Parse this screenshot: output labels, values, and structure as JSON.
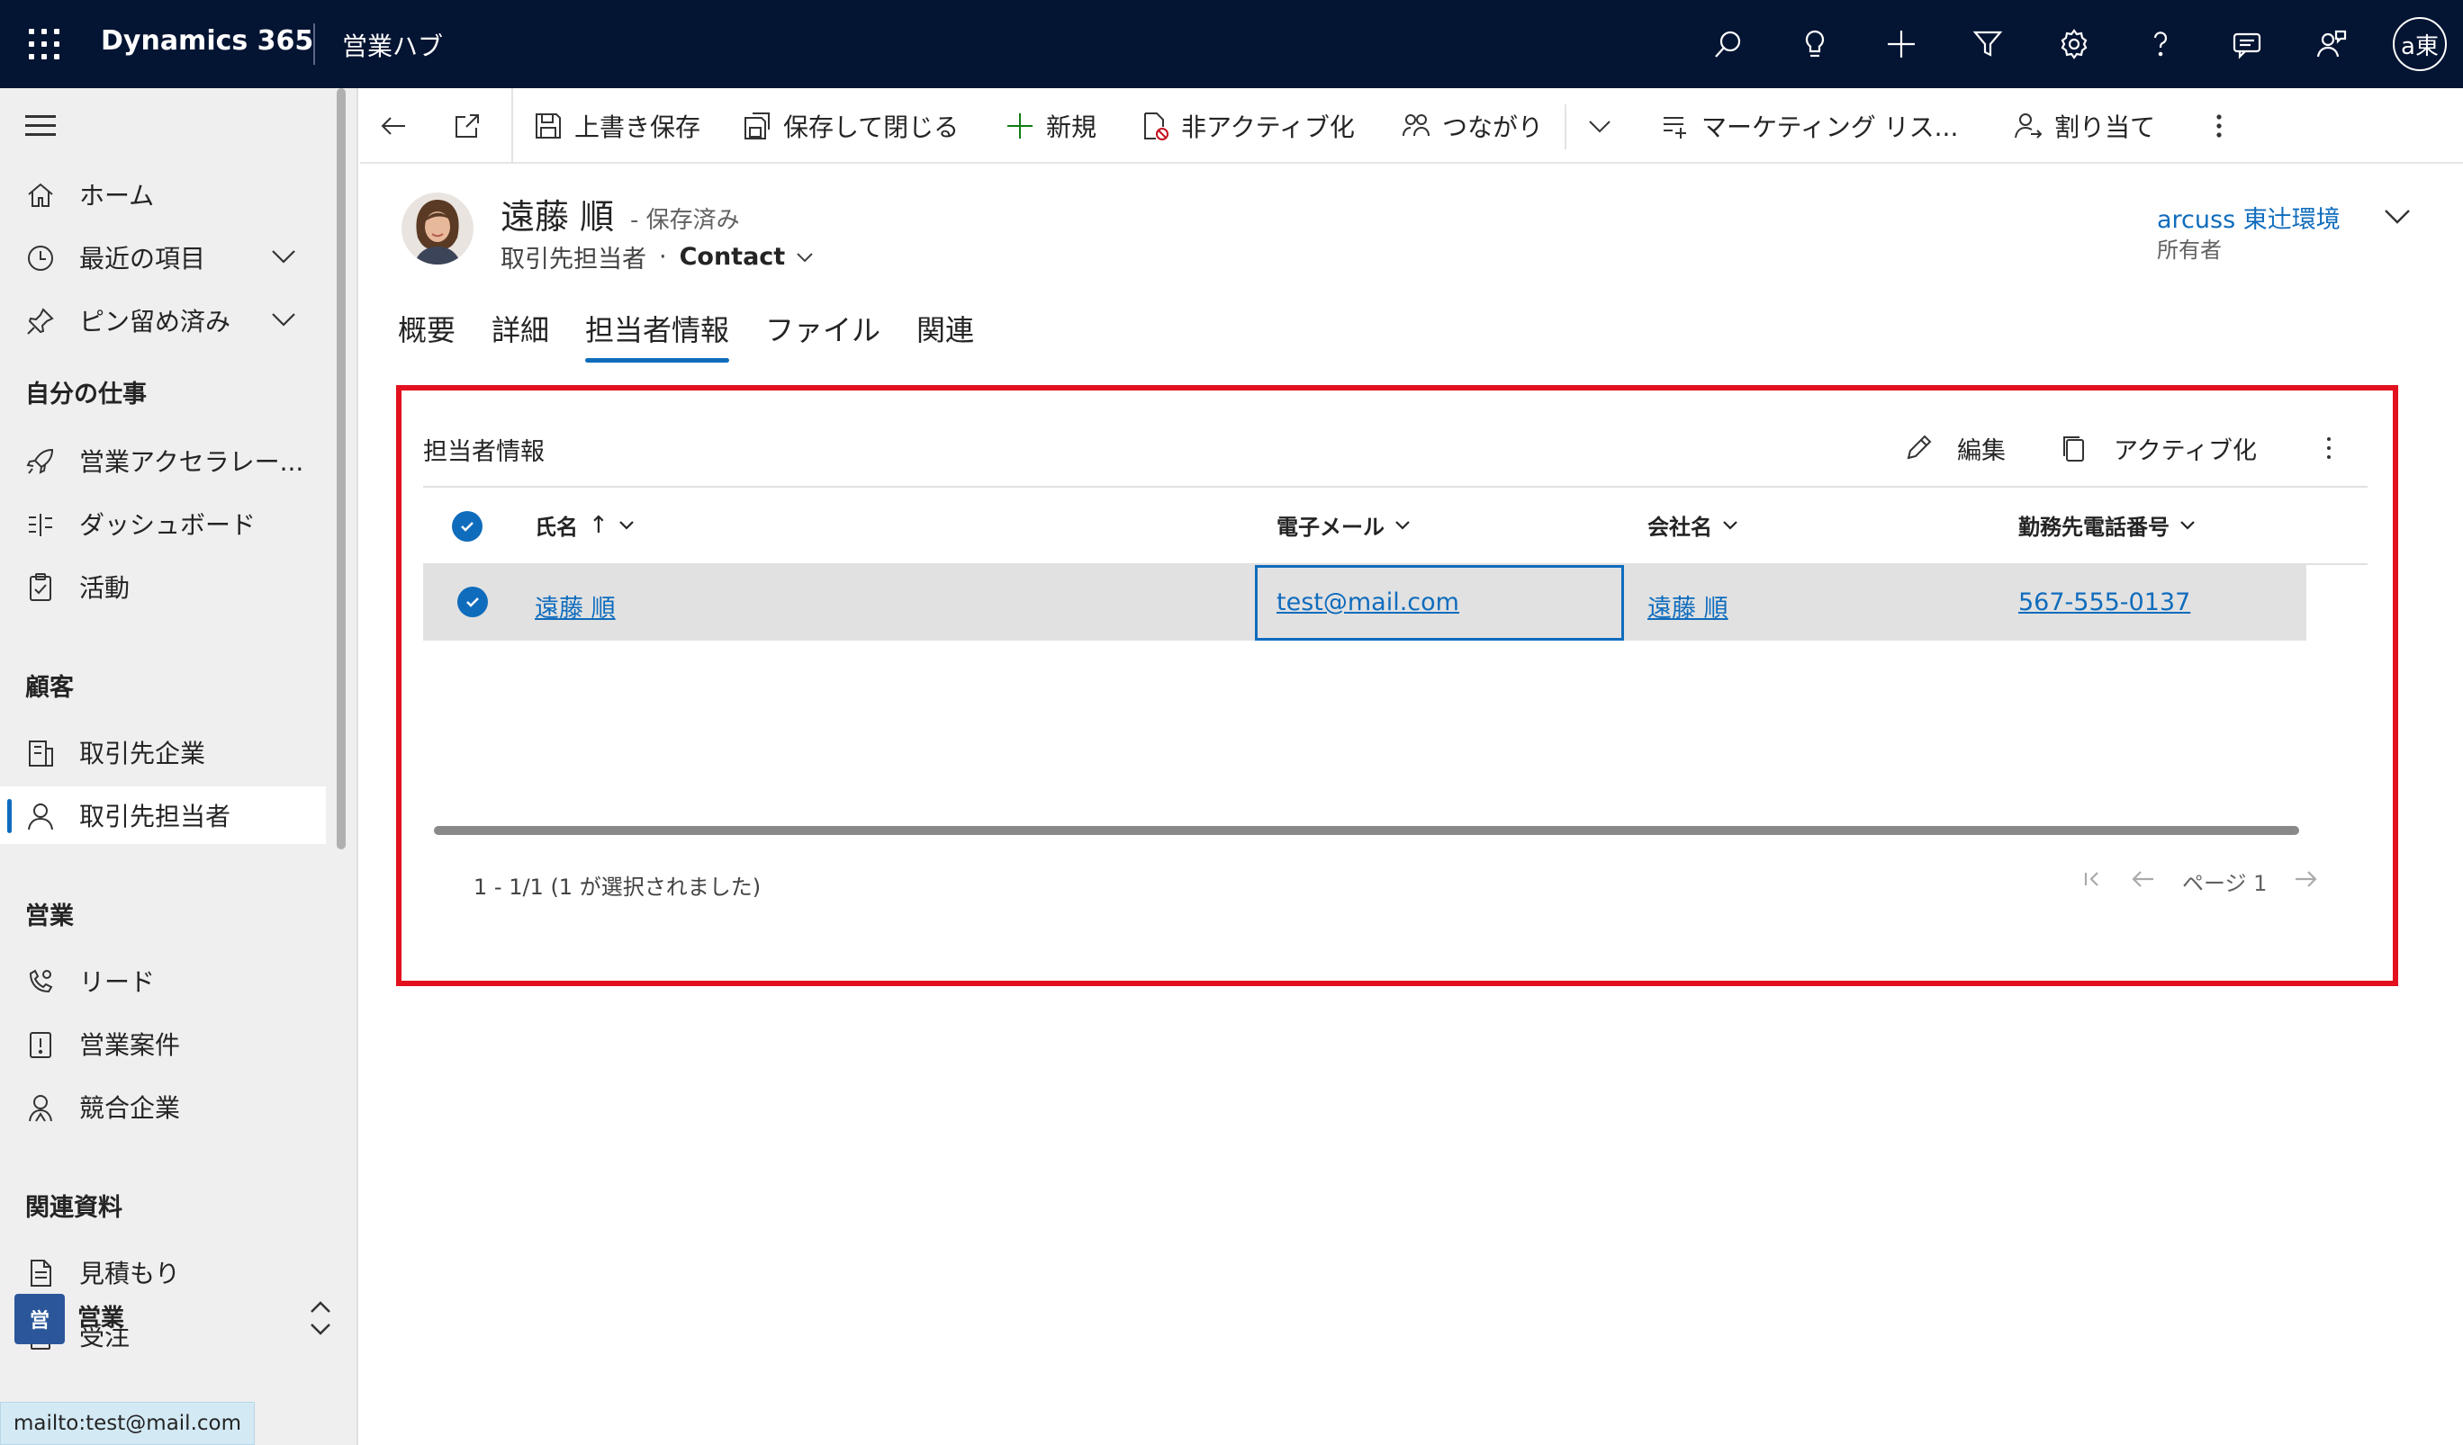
{
  "topbar": {
    "app_name": "Dynamics 365",
    "hub_name": "営業ハブ",
    "user_initials": "a東"
  },
  "icons": {
    "search": "search-icon",
    "lightbulb": "lightbulb-icon",
    "add": "plus-icon",
    "filter": "filter-icon",
    "settings": "gear-icon",
    "help": "help-icon",
    "chat": "chat-icon",
    "assistant": "person-feedback-icon"
  },
  "sidebar": {
    "items": [
      {
        "label": "ホーム"
      },
      {
        "label": "最近の項目"
      },
      {
        "label": "ピン留め済み"
      },
      {
        "label": "営業アクセラレー..."
      },
      {
        "label": "ダッシュボード"
      },
      {
        "label": "活動"
      },
      {
        "label": "取引先企業"
      },
      {
        "label": "取引先担当者"
      },
      {
        "label": "リード"
      },
      {
        "label": "営業案件"
      },
      {
        "label": "競合企業"
      },
      {
        "label": "見積もり"
      },
      {
        "label": "受注"
      }
    ],
    "groups": {
      "my_work": "自分の仕事",
      "customers": "顧客",
      "sales": "営業",
      "collateral": "関連資料"
    },
    "area_badge": "営",
    "area_label": "営業",
    "status_url": "mailto:test@mail.com"
  },
  "commandbar": {
    "save": "上書き保存",
    "save_close": "保存して閉じる",
    "new": "新規",
    "deactivate": "非アクティブ化",
    "connect": "つながり",
    "marketing_list": "マーケティング リス...",
    "assign": "割り当て"
  },
  "record": {
    "name": "遠藤 順",
    "status": "- 保存済み",
    "entity": "取引先担当者",
    "form": "Contact",
    "owner_name": "arcuss 東辻環境",
    "owner_label": "所有者"
  },
  "tabs": [
    {
      "label": "概要"
    },
    {
      "label": "詳細"
    },
    {
      "label": "担当者情報",
      "active": true
    },
    {
      "label": "ファイル"
    },
    {
      "label": "関連"
    }
  ],
  "subgrid": {
    "title": "担当者情報",
    "edit": "編集",
    "activate": "アクティブ化",
    "columns": [
      "氏名",
      "電子メール",
      "会社名",
      "勤務先電話番号"
    ],
    "sort_indicator": "↑",
    "rows": [
      {
        "name": "遠藤 順",
        "email": "test@mail.com",
        "company": "遠藤 順",
        "phone": "567-555-0137",
        "selected": true
      }
    ],
    "footer_count": "1 - 1/1 (1 が選択されました)",
    "page_label": "ページ 1"
  },
  "colors": {
    "topbar_bg": "#041433",
    "accent": "#0f6cbd",
    "highlight_frame": "#e3101e",
    "selected_row": "#e1e1e1"
  }
}
